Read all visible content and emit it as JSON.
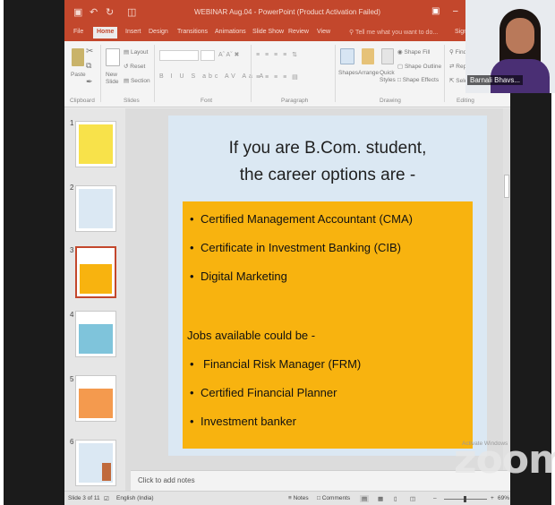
{
  "app": {
    "title": "WEBINAR Aug.04 - PowerPoint (Product Activation Failed)",
    "qa_icons": [
      "save-icon",
      "undo-icon",
      "redo-icon",
      "present-icon"
    ],
    "colors": {
      "accent": "#c3472c",
      "slide_bg": "#dbe8f3",
      "box": "#f8b30f"
    }
  },
  "tabs": [
    {
      "label": "File"
    },
    {
      "label": "Home"
    },
    {
      "label": "Insert"
    },
    {
      "label": "Design"
    },
    {
      "label": "Transitions"
    },
    {
      "label": "Animations"
    },
    {
      "label": "Slide Show"
    },
    {
      "label": "Review"
    },
    {
      "label": "View"
    }
  ],
  "tell_me": "Tell me what you want to do...",
  "sign_in": "Sign",
  "ribbon": {
    "paste": "Paste",
    "new_slide": "New\nSlide",
    "layout": "Layout",
    "reset": "Reset",
    "section": "Section",
    "shapes": "Shapes",
    "arrange": "Arrange",
    "quick_styles": "Quick\nStyles",
    "shape_fill": "Shape Fill",
    "shape_outline": "Shape Outline",
    "shape_effects": "Shape Effects",
    "find": "Find",
    "replace": "Repl",
    "select": "Sele",
    "groups": {
      "clipboard": "Clipboard",
      "slides": "Slides",
      "font": "Font",
      "paragraph": "Paragraph",
      "drawing": "Drawing",
      "editing": "Editing"
    }
  },
  "thumbnails": [
    {
      "num": "1"
    },
    {
      "num": "2"
    },
    {
      "num": "3"
    },
    {
      "num": "4"
    },
    {
      "num": "5"
    },
    {
      "num": "6"
    }
  ],
  "slide": {
    "title_line1": "If you are B.Com. student,",
    "title_line2": "the career options are -",
    "bullets": [
      "Certified Management Accountant (CMA)",
      "Certificate in Investment Banking (CIB)",
      "Digital Marketing"
    ],
    "jobs_label": "Jobs available could be -",
    "jobs": [
      "Financial Risk Manager (FRM)",
      "Certified Financial Planner",
      "Investment banker"
    ]
  },
  "notes_placeholder": "Click to add notes",
  "status": {
    "slide_info": "Slide 3 of 11",
    "language": "English (India)",
    "notes": "Notes",
    "comments": "Comments",
    "zoom": "69%"
  },
  "webcam": {
    "name": "Barnali Bhavs..."
  },
  "watermark": "zoom",
  "activate": "Activate Windows"
}
